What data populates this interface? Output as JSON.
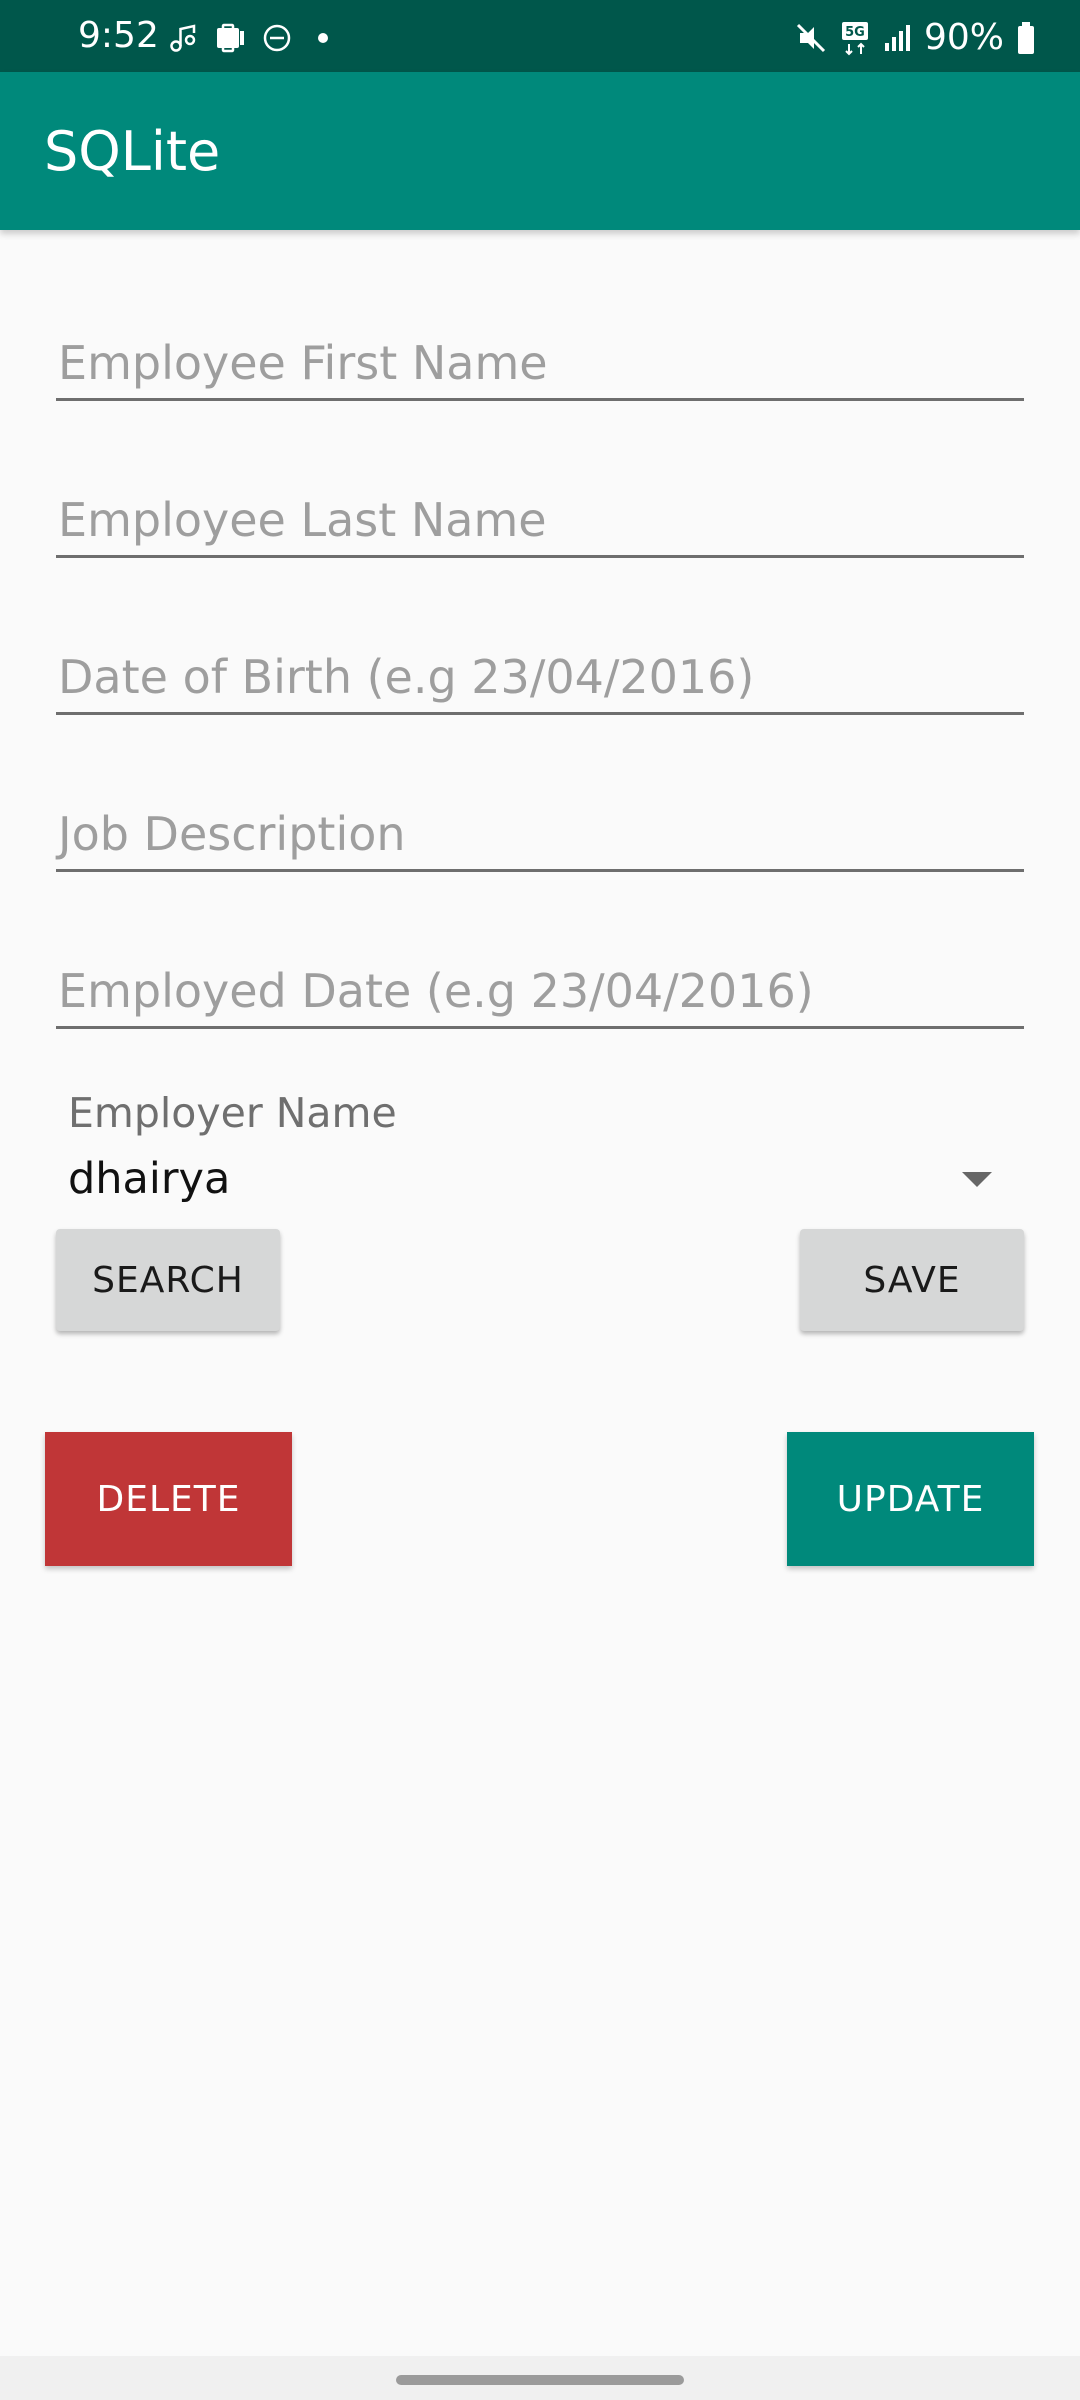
{
  "status_bar": {
    "time": "9:52",
    "battery": "90%",
    "network": "5G",
    "left_icons": [
      "music-note-icon",
      "device-icon",
      "do-not-disturb-icon",
      "notification-dot-icon"
    ],
    "right_icons": [
      "mute-icon",
      "5g-icon",
      "signal-icon",
      "battery-icon"
    ],
    "background": "#00574b"
  },
  "app_bar": {
    "title": "SQLite",
    "background": "#00897b"
  },
  "form": {
    "fields": [
      {
        "name": "first-name-field",
        "placeholder": "Employee First Name"
      },
      {
        "name": "last-name-field",
        "placeholder": "Employee Last Name"
      },
      {
        "name": "dob-field",
        "placeholder": "Date of Birth (e.g 23/04/2016)"
      },
      {
        "name": "job-description-field",
        "placeholder": "Job Description"
      },
      {
        "name": "employed-date-field",
        "placeholder": "Employed Date (e.g 23/04/2016)"
      }
    ],
    "employer_label": "Employer Name",
    "employer_value": "dhairya"
  },
  "buttons": {
    "search": "SEARCH",
    "save": "SAVE",
    "delete": "DELETE",
    "update": "UPDATE",
    "delete_color": "#c03637",
    "update_color": "#00897b"
  }
}
